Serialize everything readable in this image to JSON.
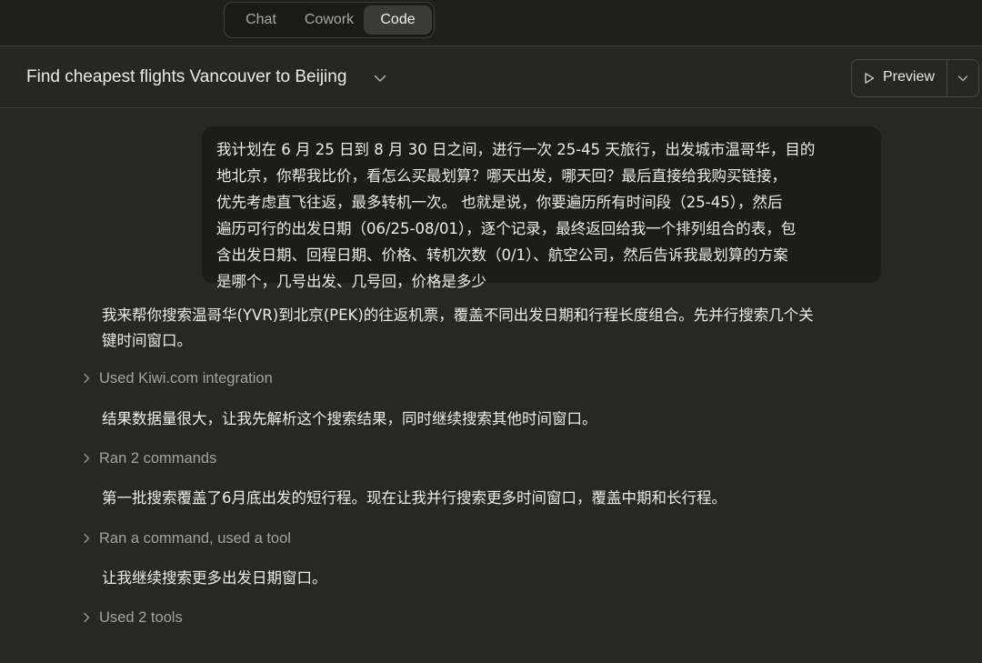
{
  "modes": [
    {
      "label": "Chat",
      "active": false
    },
    {
      "label": "Cowork",
      "active": false
    },
    {
      "label": "Code",
      "active": true
    }
  ],
  "header": {
    "title": "Find cheapest flights Vancouver to Beijing",
    "preview_label": "Preview"
  },
  "conversation": {
    "user_message": "我计划在 6 月 25 日到 8 月 30 日之间，进行一次 25-45 天旅行，出发城市温哥华，目的\n地北京，你帮我比价，看怎么买最划算？哪天出发，哪天回？最后直接给我购买链接，\n优先考虑直飞往返，最多转机一次。 也就是说，你要遍历所有时间段（25-45），然后\n遍历可行的出发日期（06/25-08/01），逐个记录，最终返回给我一个排列组合的表，包\n含出发日期、回程日期、价格、转机次数（0/1）、航空公司，然后告诉我最划算的方案\n是哪个，几号出发、几号回，价格是多少",
    "assistant_1": "我来帮你搜索温哥华(YVR)到北京(PEK)的往返机票，覆盖不同出发日期和行程长度组合。先并行搜索几个关\n键时间窗口。",
    "tool_1": "Used Kiwi.com integration",
    "assistant_2": "结果数据量很大，让我先解析这个搜索结果，同时继续搜索其他时间窗口。",
    "tool_2": "Ran 2 commands",
    "assistant_3": "第一批搜索覆盖了6月底出发的短行程。现在让我并行搜索更多时间窗口，覆盖中期和长行程。",
    "tool_3": "Ran a command, used a tool",
    "assistant_4": "让我继续搜索更多出发日期窗口。",
    "tool_4": "Used 2 tools"
  }
}
